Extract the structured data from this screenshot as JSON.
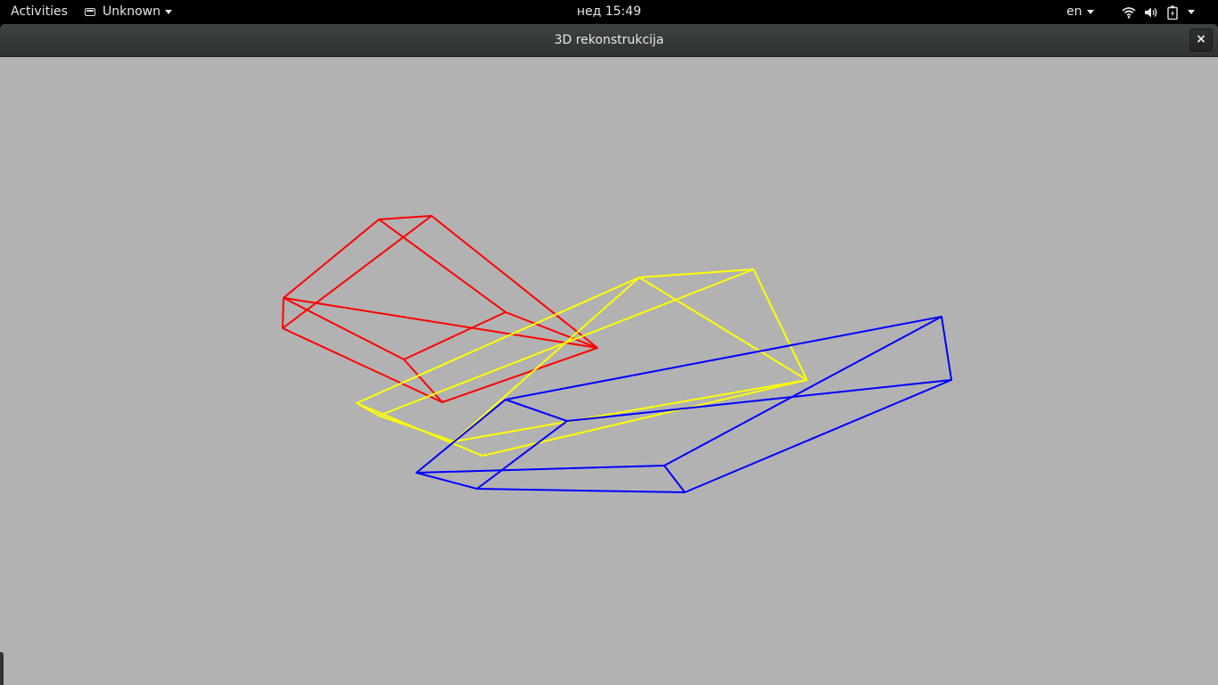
{
  "topbar": {
    "activities_label": "Activities",
    "app_menu_label": "Unknown",
    "clock": "нед 15:49",
    "language": "en",
    "tray_icons": [
      "wifi-icon",
      "volume-icon",
      "battery-icon",
      "system-menu-icon"
    ]
  },
  "window": {
    "title": "3D rekonstrukcija",
    "close_label": "×"
  },
  "scene": {
    "background_color": "#b2b2b2",
    "objects": [
      {
        "name": "red-wireframe",
        "color": "#ff0000"
      },
      {
        "name": "yellow-wireframe",
        "color": "#ffff00"
      },
      {
        "name": "blue-wireframe",
        "color": "#0000ff"
      }
    ]
  }
}
